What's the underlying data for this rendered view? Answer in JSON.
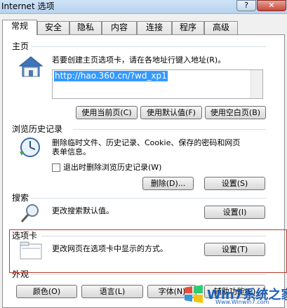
{
  "window": {
    "title": "Internet 选项"
  },
  "tabs": [
    {
      "label": "常规",
      "active": true
    },
    {
      "label": "安全"
    },
    {
      "label": "隐私"
    },
    {
      "label": "内容"
    },
    {
      "label": "连接"
    },
    {
      "label": "程序"
    },
    {
      "label": "高级"
    }
  ],
  "home": {
    "title": "主页",
    "desc": "若要创建主页选项卡，请在各地址行键入地址(R)。",
    "url": "http://hao.360.cn/?wd_xp1",
    "btn_current": "使用当前页(C)",
    "btn_default": "使用默认值(F)",
    "btn_blank": "使用空白页(B)"
  },
  "history": {
    "title": "浏览历史记录",
    "desc_line1": "删除临时文件、历史记录、Cookie、保存的密码和网页",
    "desc_line2": "表单信息。",
    "checkbox_label": "退出时删除浏览历史记录(W)",
    "btn_delete": "删除(D)...",
    "btn_settings": "设置(S)"
  },
  "search": {
    "title": "搜索",
    "desc": "更改搜索默认值。",
    "btn_settings": "设置(I)"
  },
  "tabs_section": {
    "title": "选项卡",
    "desc": "更改网页在选项卡中显示的方式。",
    "btn_settings": "设置(T)"
  },
  "appearance": {
    "title": "外观",
    "btn_colors": "颜色(O)",
    "btn_languages": "语言(L)",
    "btn_fonts": "字体(N)",
    "btn_accessibility": "辅助功能(E)"
  },
  "watermark": {
    "text": "Win7系统之家",
    "sub": "Www.Winwin7.com"
  },
  "colors": {
    "selection": "#3399ff",
    "highlight_box": "#c0392b"
  }
}
